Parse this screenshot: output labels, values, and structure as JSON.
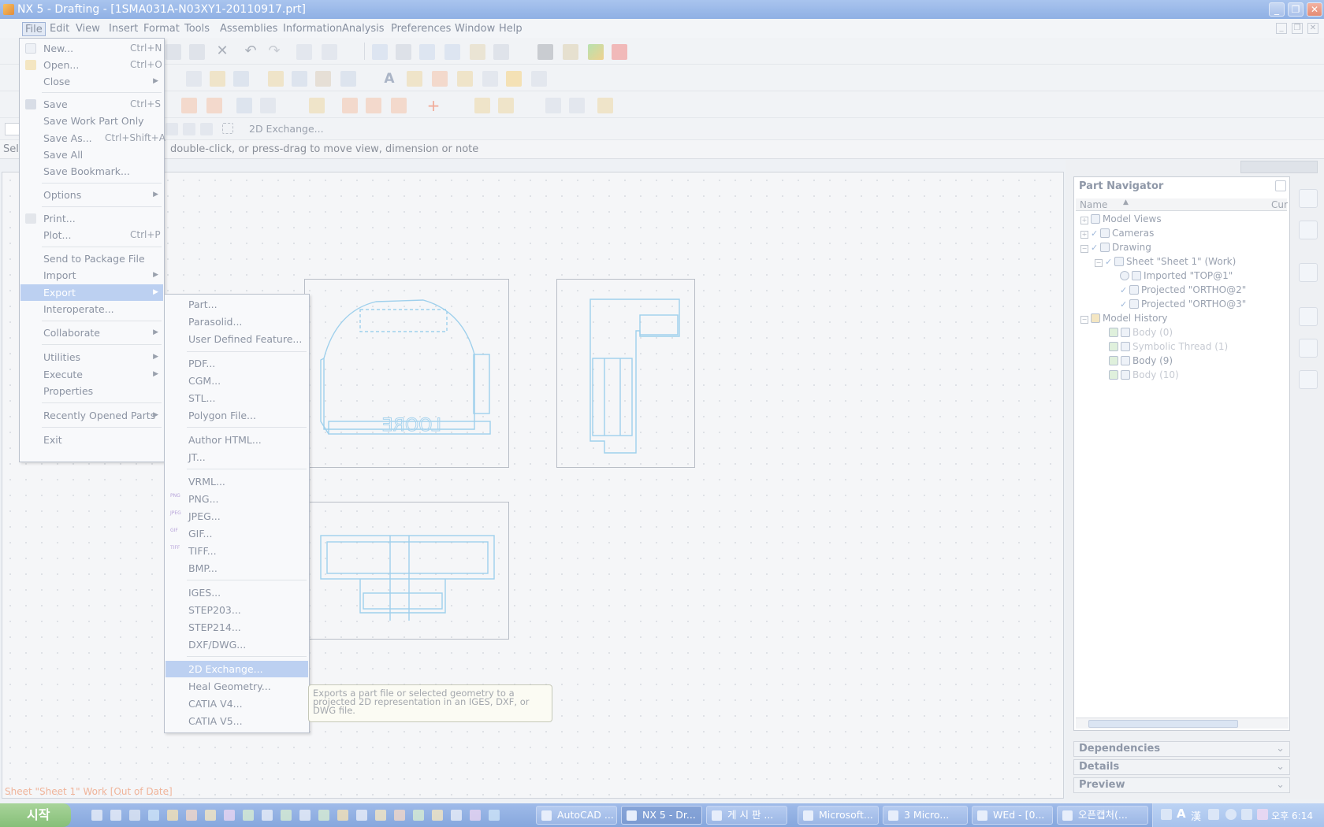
{
  "window": {
    "title": "NX 5 - Drafting - [1SMA031A-N03XY1-20110917.prt]"
  },
  "menubar": [
    "File",
    "Edit",
    "View",
    "Insert",
    "Format",
    "Tools",
    "Assemblies",
    "Information",
    "Analysis",
    "Preferences",
    "Window",
    "Help"
  ],
  "toolbar": {
    "sel_prefix": "Sel",
    "exchange_label": "2D Exchange..."
  },
  "status": {
    "cue": "double-click, or press-drag to move view, dimension or note",
    "sheet_status": "Sheet \"Sheet 1\" Work [Out of Date]"
  },
  "file_menu": {
    "items": [
      {
        "label": "New...",
        "shortcut": "Ctrl+N"
      },
      {
        "label": "Open...",
        "shortcut": "Ctrl+O"
      },
      {
        "label": "Close",
        "shortcut": ""
      },
      {
        "label": "Save",
        "shortcut": "Ctrl+S"
      },
      {
        "label": "Save Work Part Only",
        "shortcut": ""
      },
      {
        "label": "Save As...",
        "shortcut": "Ctrl+Shift+A"
      },
      {
        "label": "Save All",
        "shortcut": ""
      },
      {
        "label": "Save Bookmark...",
        "shortcut": ""
      },
      {
        "label": "Options",
        "shortcut": ""
      },
      {
        "label": "Print...",
        "shortcut": ""
      },
      {
        "label": "Plot...",
        "shortcut": "Ctrl+P"
      },
      {
        "label": "Send to Package File",
        "shortcut": ""
      },
      {
        "label": "Import",
        "shortcut": ""
      },
      {
        "label": "Export",
        "shortcut": ""
      },
      {
        "label": "Interoperate...",
        "shortcut": ""
      },
      {
        "label": "Collaborate",
        "shortcut": ""
      },
      {
        "label": "Utilities",
        "shortcut": ""
      },
      {
        "label": "Execute",
        "shortcut": ""
      },
      {
        "label": "Properties",
        "shortcut": ""
      },
      {
        "label": "Recently Opened Parts",
        "shortcut": ""
      },
      {
        "label": "Exit",
        "shortcut": ""
      }
    ]
  },
  "export_menu": {
    "items": [
      "Part...",
      "Parasolid...",
      "User Defined Feature...",
      "PDF...",
      "CGM...",
      "STL...",
      "Polygon File...",
      "Author HTML...",
      "JT...",
      "VRML...",
      "PNG...",
      "JPEG...",
      "GIF...",
      "TIFF...",
      "BMP...",
      "IGES...",
      "STEP203...",
      "STEP214...",
      "DXF/DWG...",
      "2D Exchange...",
      "Heal Geometry...",
      "CATIA V4...",
      "CATIA V5..."
    ],
    "icon_badges": [
      "PNG",
      "JPEG",
      "GIF",
      "TIFF"
    ]
  },
  "tooltip": {
    "text": "Exports a part file or selected geometry to a projected 2D representation in an IGES, DXF, or DWG file."
  },
  "part_navigator": {
    "title": "Part Navigator",
    "col_name": "Name",
    "col_cur": "Cur",
    "tree": [
      {
        "label": "Model Views",
        "level": 0,
        "dim": false
      },
      {
        "label": "Cameras",
        "level": 0,
        "dim": false
      },
      {
        "label": "Drawing",
        "level": 0,
        "dim": false
      },
      {
        "label": "Sheet \"Sheet 1\" (Work)",
        "level": 1,
        "dim": false
      },
      {
        "label": "Imported \"TOP@1\"",
        "level": 2,
        "dim": false
      },
      {
        "label": "Projected \"ORTHO@2\"",
        "level": 2,
        "dim": false
      },
      {
        "label": "Projected \"ORTHO@3\"",
        "level": 2,
        "dim": false
      },
      {
        "label": "Model History",
        "level": 0,
        "dim": false
      },
      {
        "label": "Body (0)",
        "level": 1,
        "dim": true
      },
      {
        "label": "Symbolic Thread (1)",
        "level": 1,
        "dim": true
      },
      {
        "label": "Body (9)",
        "level": 1,
        "dim": false
      },
      {
        "label": "Body (10)",
        "level": 1,
        "dim": true
      }
    ]
  },
  "panels": [
    "Dependencies",
    "Details",
    "Preview"
  ],
  "drawing": {
    "engraved_text": "LOORE"
  },
  "taskbar": {
    "start_label": "시작",
    "tasks": [
      "AutoCAD ...",
      "NX 5 - Dr...",
      "게 시 판 ...",
      "Microsoft...",
      "3 Micro...",
      "WEd - [0...",
      "오픈캡처(..."
    ],
    "clock": "오후 6:14"
  },
  "colors": {
    "title_bar": "#8fb0e4",
    "highlight": "#bcd0f1",
    "drawing_lines": "#9fd0ec",
    "sheet_status": "#f0b49a"
  }
}
